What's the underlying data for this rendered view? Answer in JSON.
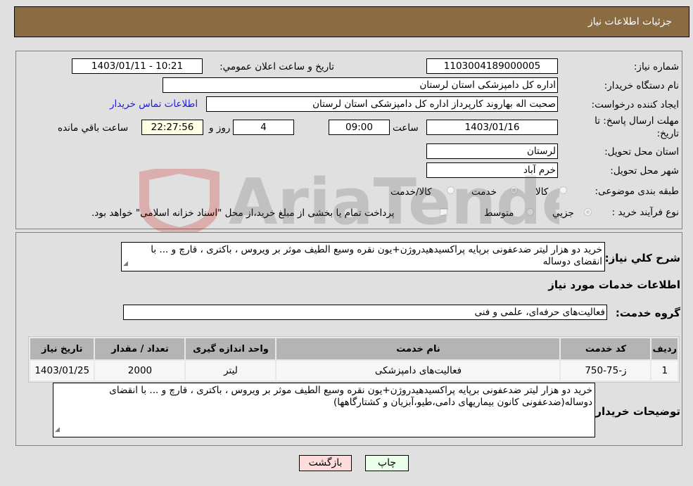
{
  "header": {
    "title": "جزئیات اطلاعات نیاز"
  },
  "fields": {
    "need_number_label": "شماره نیاز:",
    "need_number": "1103004189000005",
    "announce_label": "تاریخ و ساعت اعلان عمومي:",
    "announce_value": "1403/01/11 - 10:21",
    "buyer_org_label": "نام دستگاه خريدار:",
    "buyer_org": "اداره کل دامپزشکی استان لرستان",
    "requester_label": "ایجاد کننده درخواست:",
    "requester": "صحبت اله بهاروند کارپرداز اداره کل دامپزشکی استان لرستان",
    "contact_link": "اطلاعات تماس خریدار",
    "deadline_label_1": "مهلت ارسال پاسخ: تا",
    "deadline_label_2": "تاریخ:",
    "deadline_date": "1403/01/16",
    "time_label": "ساعت",
    "deadline_time": "09:00",
    "days_value": "4",
    "days_label": "روز و",
    "remaining_time": "22:27:56",
    "remaining_label": "ساعت باقي مانده",
    "province_label": "استان محل تحویل:",
    "province": "لرستان",
    "city_label": "شهر محل تحویل:",
    "city": "خرم آباد",
    "category_label": "طبقه بندی موضوعی:",
    "category_options": [
      "کالا",
      "خدمت",
      "کالا/خدمت"
    ],
    "category_selected": "خدمت",
    "process_label": "نوع فرآیند خرید :",
    "process_options": [
      "جزيي",
      "متوسط"
    ],
    "process_selected": "جزيي",
    "treasury_note": "پرداخت تمام یا بخشی از مبلغ خرید،از محل \"اسناد خزانه اسلامی\" خواهد بود."
  },
  "description": {
    "label": "شرح کلي نياز:",
    "text": "خرید دو هزار لیتر ضدعفونی برپایه پراکسیدهیدروژن+یون نقره وسیع الطیف موثر بر ویروس ، باکتری ، قارچ و ... با انقضای دوساله"
  },
  "services": {
    "section_title": "اطلاعات خدمات مورد نياز",
    "group_label": "گروه خدمت:",
    "group_value": "فعالیت‌های حرفه‌ای، علمی و فنی",
    "columns": [
      "رديف",
      "کد خدمت",
      "نام خدمت",
      "واحد اندازه گيری",
      "تعداد / مقدار",
      "تاريخ نياز"
    ],
    "rows": [
      {
        "row": "1",
        "code": "ز-75-750",
        "name": "فعالیت‌های دامپزشکی",
        "unit": "لیتر",
        "qty": "2000",
        "date": "1403/01/25"
      }
    ]
  },
  "buyer_notes": {
    "label": "توضيحات خريدار:",
    "text": "خرید دو هزار لیتر ضدعفونی برپایه پراکسیدهیدروژن+یون نقره وسیع الطیف موثر بر ویروس ، باکتری ، قارچ و ... با انقضای دوساله(ضدعفونی کانون بیماریهای دامی،طیو،آبزیان و کشتارگاهها)"
  },
  "buttons": {
    "print": "چاپ",
    "back": "بازگشت"
  },
  "colors": {
    "header_bg": "#8b6c42",
    "print_bg": "#eaffea",
    "back_bg": "#ffdcdc",
    "link": "#1a1adb"
  }
}
